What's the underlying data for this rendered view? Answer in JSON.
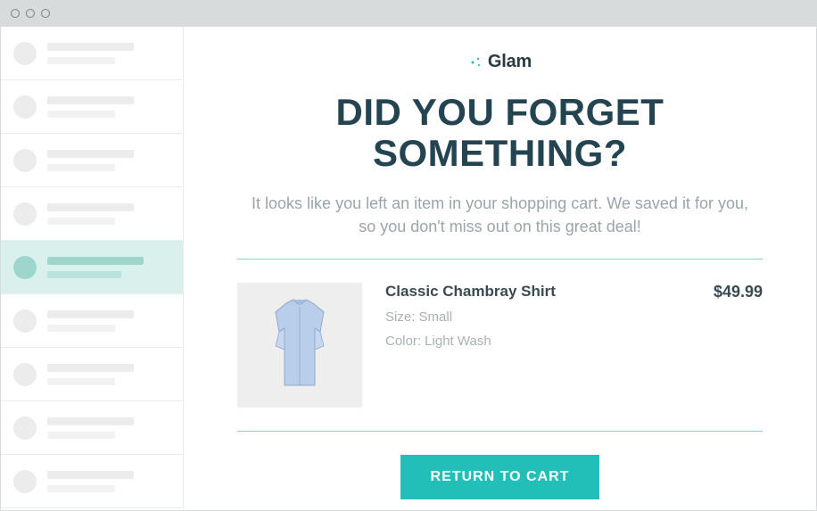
{
  "brand": {
    "name": "Glam"
  },
  "headline": "DID YOU FORGET SOMETHING?",
  "subhead": "It looks like you left an item in your shopping cart. We saved it for you, so you don't miss out on this great deal!",
  "product": {
    "name": "Classic Chambray Shirt",
    "price": "$49.99",
    "size_label": "Size: Small",
    "color_label": "Color: Light Wash"
  },
  "cta_label": "RETURN TO CART",
  "sidebar": {
    "items": [
      {
        "selected": false
      },
      {
        "selected": false
      },
      {
        "selected": false
      },
      {
        "selected": false
      },
      {
        "selected": true
      },
      {
        "selected": false
      },
      {
        "selected": false
      },
      {
        "selected": false
      },
      {
        "selected": false
      }
    ]
  }
}
